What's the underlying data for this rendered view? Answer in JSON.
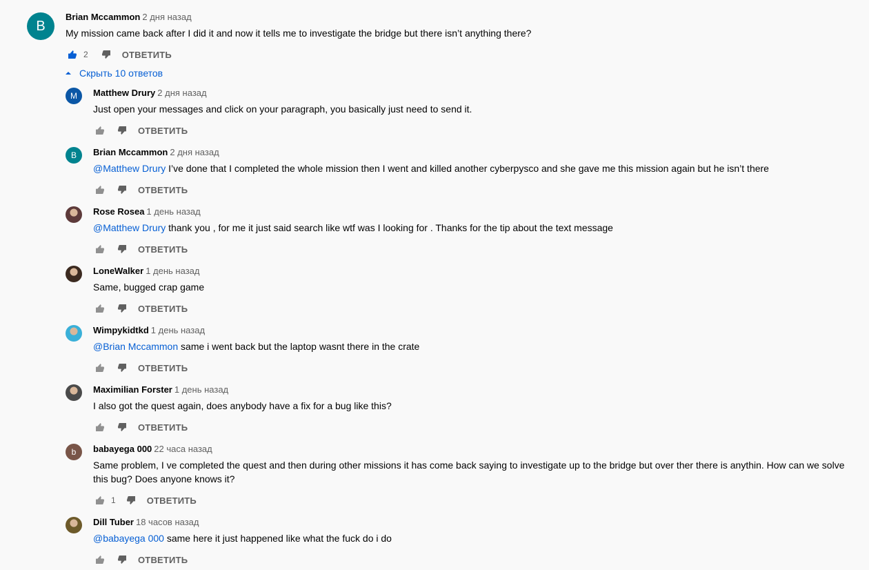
{
  "colors": {
    "link": "#065fd4",
    "icon_gray": "#909090",
    "like_active": "#065fd4"
  },
  "parent": {
    "author": "Brian Mccammon",
    "time": "2 дня назад",
    "text": "My mission came back after I did it and now it tells me to investigate the bridge but there isn’t anything there?",
    "avatar_letter": "B",
    "avatar_color": "#00838f",
    "likes": "2",
    "reply_label": "ОТВЕТИТЬ"
  },
  "toggle_label": "Скрыть 10 ответов",
  "replies": [
    {
      "author": "Matthew Drury",
      "time": "2 дня назад",
      "mention": "",
      "text": "Just open your messages and click on your paragraph, you basically just need to send it.",
      "avatar_letter": "M",
      "avatar_color": "#0b57a6",
      "likes": "",
      "reply_label": "ОТВЕТИТЬ"
    },
    {
      "author": "Brian Mccammon",
      "time": "2 дня назад",
      "mention": "@Matthew Drury",
      "text": "I’ve done that I completed the whole mission then I went and killed another cyberpysco and she gave me this mission again but he isn’t there",
      "avatar_letter": "B",
      "avatar_color": "#00838f",
      "likes": "",
      "reply_label": "ОТВЕТИТЬ"
    },
    {
      "author": "Rose Rosea",
      "time": "1 день назад",
      "mention": "@Matthew Drury",
      "text": "thank you , for me it just said search like wtf was I looking for . Thanks for the tip about the text message",
      "avatar_letter": "",
      "avatar_color": "#5d3a3a",
      "likes": "",
      "reply_label": "ОТВЕТИТЬ"
    },
    {
      "author": "LoneWalker",
      "time": "1 день назад",
      "mention": "",
      "text": "Same, bugged crap game",
      "avatar_letter": "",
      "avatar_color": "#3b2a20",
      "likes": "",
      "reply_label": "ОТВЕТИТЬ"
    },
    {
      "author": "Wimpykidtkd",
      "time": "1 день назад",
      "mention": "@Brian Mccammon",
      "text": "same i went back but the laptop wasnt there in the crate",
      "avatar_letter": "",
      "avatar_color": "#3ab0d8",
      "likes": "",
      "reply_label": "ОТВЕТИТЬ"
    },
    {
      "author": "Maximilian Forster",
      "time": "1 день назад",
      "mention": "",
      "text": "I also got the quest again, does anybody have a fix for a bug like this?",
      "avatar_letter": "",
      "avatar_color": "#4a4a4a",
      "likes": "",
      "reply_label": "ОТВЕТИТЬ"
    },
    {
      "author": "babayega 000",
      "time": "22 часа назад",
      "mention": "",
      "text": "Same problem, I ve completed the quest and then during other missions it has come back saying to investigate up to the bridge but over ther there is anythin. How can we solve this bug? Does anyone knows it?",
      "avatar_letter": "b",
      "avatar_color": "#795548",
      "likes": "1",
      "reply_label": "ОТВЕТИТЬ"
    },
    {
      "author": "Dill Tuber",
      "time": "18 часов назад",
      "mention": "@babayega 000",
      "text": "same here it just happened like what the fuck do i do",
      "avatar_letter": "",
      "avatar_color": "#6d5a2a",
      "likes": "",
      "reply_label": "ОТВЕТИТЬ"
    }
  ]
}
